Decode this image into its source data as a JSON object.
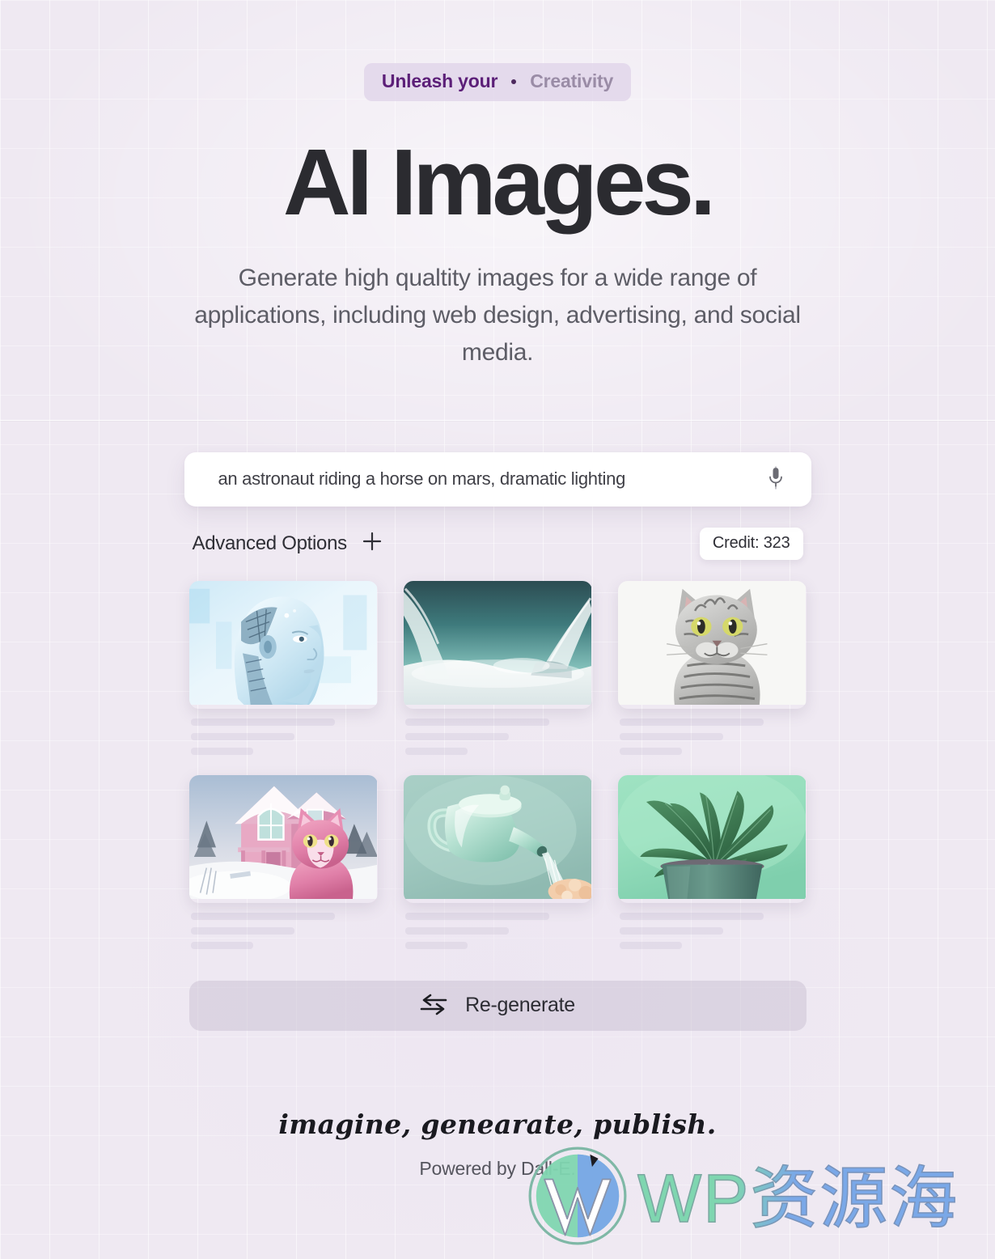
{
  "hero": {
    "eyebrow_strong": "Unleash your",
    "eyebrow_dot": "•",
    "eyebrow_soft": "Creativity",
    "title": "AI Images.",
    "subtitle": "Generate high qualtity images for a wide range of applications, including web design, advertising, and social media."
  },
  "generator": {
    "prompt_value": "an astronaut riding a horse on mars, dramatic lighting",
    "prompt_placeholder": "an astronaut riding a horse on mars, dramatic lighting",
    "mic_icon": "microphone-icon",
    "advanced_options_label": "Advanced Options",
    "plus_icon": "plus-icon",
    "credit_label": "Credit: 323",
    "regenerate_label": "Re-generate",
    "regenerate_icon": "swap-arrows-icon",
    "results": [
      {
        "name": "ai-robot-head",
        "alt": "blue humanoid AI robot head in profile"
      },
      {
        "name": "abstract-teal-landscape",
        "alt": "abstract teal and white gradient landscape"
      },
      {
        "name": "gray-tabby-cat",
        "alt": "gray tabby cat on white background"
      },
      {
        "name": "pink-cat-snow-house",
        "alt": "pink cat in front of pink house in snow"
      },
      {
        "name": "mint-watering-can",
        "alt": "mint green watering can pouring water"
      },
      {
        "name": "potted-plant",
        "alt": "green potted plant on mint background"
      }
    ]
  },
  "footer": {
    "tagline": "imagine, genearate, publish.",
    "powered_by": "Powered by Dall-E."
  },
  "watermark": {
    "logo_icon": "wordpress-logo-icon",
    "text": "WP资源海"
  },
  "colors": {
    "page_bg": "#efe9f2",
    "accent_purple": "#5c1f78",
    "eyebrow_bg": "#dfd3e9",
    "title": "#2b2b30",
    "body_text": "#5d5d66",
    "card_white": "#ffffff",
    "regen_bg": "#c4bace",
    "wm_green": "#7fd6b0",
    "wm_blue": "#7aa8e8"
  }
}
